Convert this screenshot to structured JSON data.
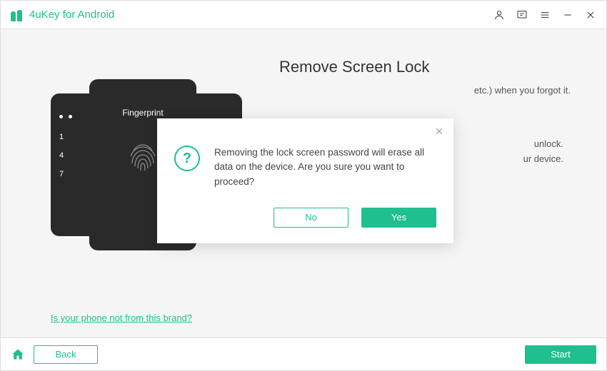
{
  "app": {
    "title": "4uKey for Android"
  },
  "page": {
    "heading": "Remove Screen Lock",
    "desc_tail": "etc.) when you forgot it.",
    "info_line1": "unlock.",
    "info_line2": "ur device.",
    "brand_link": "Is your phone not from this brand?"
  },
  "phone": {
    "fp_label": "Fingerprint",
    "nums": [
      "1",
      "4",
      "7"
    ]
  },
  "modal": {
    "message": "Removing the lock screen password will erase all data on the device. Are you sure you want to proceed?",
    "no": "No",
    "yes": "Yes"
  },
  "footer": {
    "back": "Back",
    "start": "Start"
  }
}
